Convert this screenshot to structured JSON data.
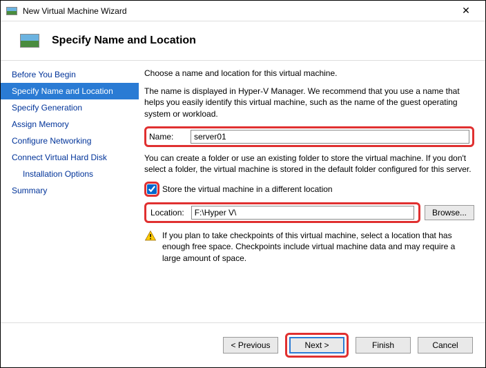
{
  "window": {
    "title": "New Virtual Machine Wizard"
  },
  "header": {
    "title": "Specify Name and Location"
  },
  "sidebar": {
    "items": [
      {
        "label": "Before You Begin"
      },
      {
        "label": "Specify Name and Location"
      },
      {
        "label": "Specify Generation"
      },
      {
        "label": "Assign Memory"
      },
      {
        "label": "Configure Networking"
      },
      {
        "label": "Connect Virtual Hard Disk"
      },
      {
        "label": "Installation Options"
      },
      {
        "label": "Summary"
      }
    ],
    "active_index": 1,
    "indent_index": 6
  },
  "content": {
    "intro": "Choose a name and location for this virtual machine.",
    "name_help": "The name is displayed in Hyper-V Manager. We recommend that you use a name that helps you easily identify this virtual machine, such as the name of the guest operating system or workload.",
    "name_label": "Name:",
    "name_value": "server01",
    "folder_help": "You can create a folder or use an existing folder to store the virtual machine. If you don't select a folder, the virtual machine is stored in the default folder configured for this server.",
    "store_checkbox_label": "Store the virtual machine in a different location",
    "store_checked": true,
    "location_label": "Location:",
    "location_value": "F:\\Hyper V\\",
    "browse_label": "Browse...",
    "warning_text": "If you plan to take checkpoints of this virtual machine, select a location that has enough free space. Checkpoints include virtual machine data and may require a large amount of space."
  },
  "footer": {
    "previous": "< Previous",
    "next": "Next >",
    "finish": "Finish",
    "cancel": "Cancel"
  }
}
